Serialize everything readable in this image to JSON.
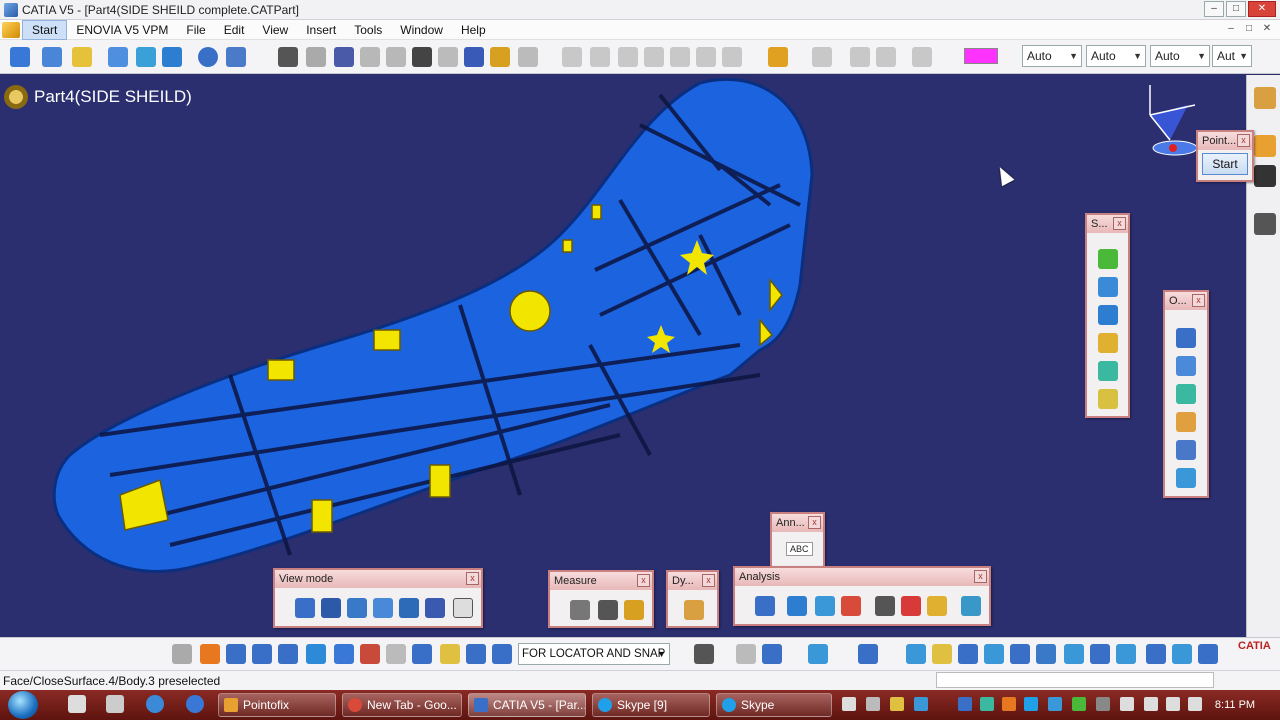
{
  "window": {
    "title": "CATIA V5 - [Part4(SIDE SHEILD complete.CATPart]",
    "btn_min": "–",
    "btn_max": "□",
    "btn_close": "✕"
  },
  "menu": {
    "items": [
      "Start",
      "ENOVIA V5 VPM",
      "File",
      "Edit",
      "View",
      "Insert",
      "Tools",
      "Window",
      "Help"
    ]
  },
  "toolbar": {
    "color_swatch": "#ff33ff",
    "selects": [
      "Auto",
      "Auto",
      "Auto",
      "Aut"
    ]
  },
  "viewport": {
    "part_title": "Part4(SIDE SHEILD)",
    "part_color": "#1c63e0",
    "background": "#2b2f6f"
  },
  "palettes": {
    "point": {
      "title": "Point...",
      "start_label": "Start"
    },
    "sketch": {
      "title": "S..."
    },
    "operations": {
      "title": "O..."
    },
    "annotations": {
      "title": "Ann...",
      "abc": "ABC"
    },
    "analysis": {
      "title": "Analysis"
    },
    "view_mode": {
      "title": "View mode"
    },
    "measure": {
      "title": "Measure"
    },
    "dynamic": {
      "title": "Dy..."
    }
  },
  "bottom_toolbar": {
    "selection_mode": "FOR LOCATOR AND SNAP",
    "logo": "CATIA"
  },
  "status": {
    "text": "Face/CloseSurface.4/Body.3 preselected"
  },
  "taskbar": {
    "tasks": [
      {
        "label": "Pointofix",
        "color": "#e8a030"
      },
      {
        "label": "New Tab - Goo...",
        "color": "#d94a3a"
      },
      {
        "label": "CATIA V5 - [Par...",
        "color": "#3a6fc8"
      },
      {
        "label": "Skype [9]",
        "color": "#1fa0e8"
      },
      {
        "label": "Skype",
        "color": "#1fa0e8"
      }
    ],
    "clock": "8:11 PM"
  }
}
